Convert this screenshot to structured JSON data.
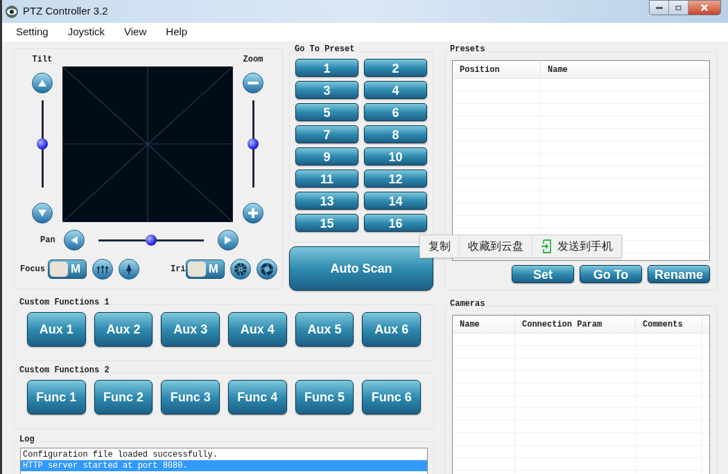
{
  "window": {
    "title": "PTZ Controller 3.2"
  },
  "menu": [
    "Setting",
    "Joystick",
    "View",
    "Help"
  ],
  "joystick": {
    "tilt_label": "Tilt",
    "zoom_label": "Zoom",
    "pan_label": "Pan",
    "tilt": {
      "level": 0.5
    },
    "zoom": {
      "level": 0.5
    },
    "pan": {
      "level": 0.5
    },
    "focus": {
      "label": "Focus",
      "mode": "M"
    },
    "iris": {
      "label": "Iri",
      "mode": "M"
    }
  },
  "go_to_preset": {
    "title": "Go To Preset",
    "buttons": [
      "1",
      "2",
      "3",
      "4",
      "5",
      "6",
      "7",
      "8",
      "9",
      "10",
      "11",
      "12",
      "13",
      "14",
      "15",
      "16"
    ]
  },
  "auto_scan": "Auto Scan",
  "presets": {
    "title": "Presets",
    "columns": [
      "Position",
      "Name"
    ],
    "buttons": [
      "Set",
      "Go To",
      "Rename"
    ]
  },
  "custom_functions_1": {
    "title": "Custom Functions 1",
    "buttons": [
      "Aux 1",
      "Aux 2",
      "Aux 3",
      "Aux 4",
      "Aux 5",
      "Aux 6"
    ]
  },
  "custom_functions_2": {
    "title": "Custom Functions 2",
    "buttons": [
      "Func 1",
      "Func 2",
      "Func 3",
      "Func 4",
      "Func 5",
      "Func 6"
    ]
  },
  "log": {
    "title": "Log",
    "lines": [
      {
        "text": "Configuration file loaded successfully.",
        "selected": false
      },
      {
        "text": "HTTP server started at port 8080.",
        "selected": true
      }
    ]
  },
  "cameras": {
    "title": "Cameras",
    "columns": [
      "Name",
      "Connection Param",
      "Comments"
    ]
  },
  "context_menu": [
    {
      "label": "复制",
      "kind": "plain"
    },
    {
      "label": "收藏到云盘",
      "kind": "plain"
    },
    {
      "label": "发送到手机",
      "kind": "phone"
    }
  ]
}
